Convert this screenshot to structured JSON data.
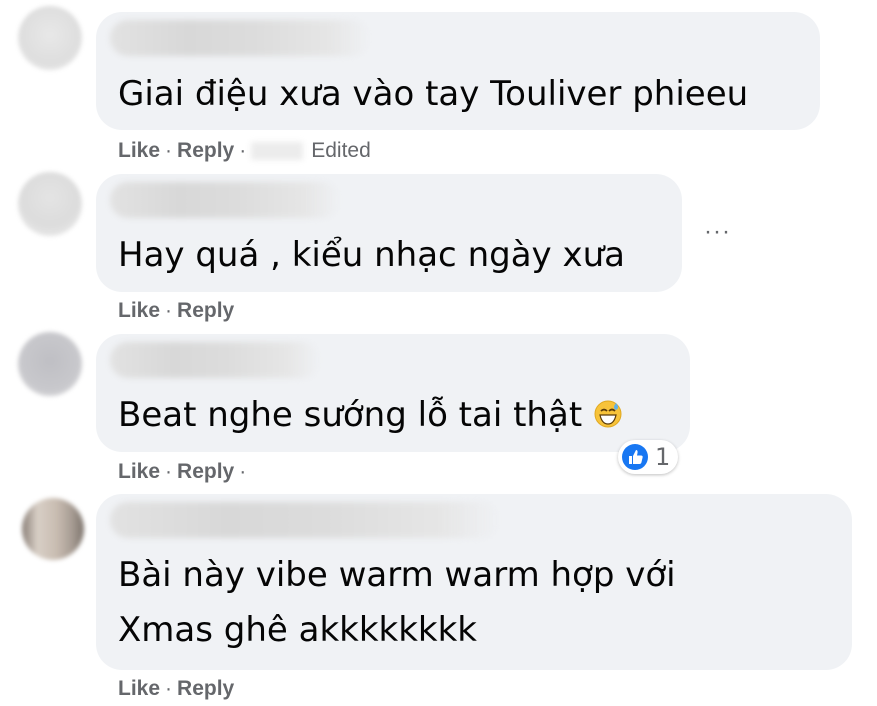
{
  "comments": [
    {
      "text_lines": [
        "Giai điệu xưa vào tay Touliver phieeu"
      ],
      "actions": {
        "like": "Like",
        "reply": "Reply",
        "edited": "Edited"
      }
    },
    {
      "text_lines": [
        "Hay quá , kiểu nhạc ngày xưa"
      ],
      "actions": {
        "like": "Like",
        "reply": "Reply"
      },
      "more_label": "···"
    },
    {
      "text_lines": [
        "Beat nghe sướng lỗ tai thật"
      ],
      "emoji": "grinning-sweat-emoji",
      "reaction": {
        "icon": "like-thumb-icon",
        "count": "1"
      },
      "actions": {
        "like": "Like",
        "reply": "Reply"
      }
    },
    {
      "text_lines": [
        "Bài này vibe warm warm hợp với",
        "Xmas ghê akkkkkkkk"
      ],
      "actions": {
        "like": "Like",
        "reply": "Reply"
      }
    }
  ],
  "separator": "·",
  "colors": {
    "bubble": "#f0f2f5",
    "text": "#050505",
    "secondary": "#65676b",
    "like_blue": "#1877f2"
  }
}
